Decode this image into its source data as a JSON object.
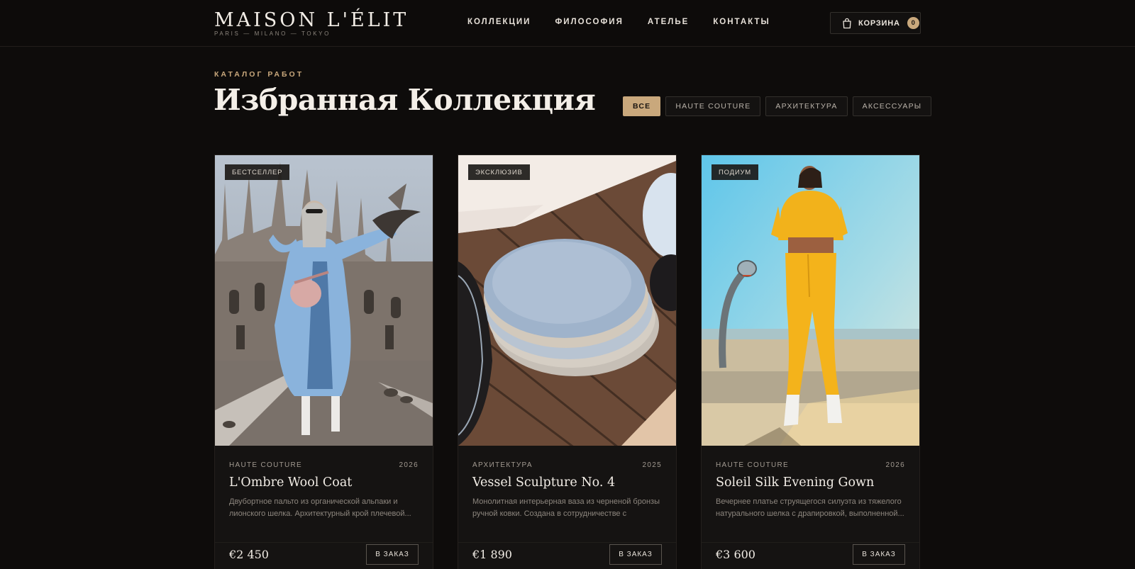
{
  "header": {
    "logo": "MAISON L'ÉLIT",
    "tagline": "PARIS — MILANO — TOKYO",
    "nav": [
      "КОЛЛЕКЦИИ",
      "ФИЛОСОФИЯ",
      "АТЕЛЬЕ",
      "КОНТАКТЫ"
    ],
    "cart_label": "КОРЗИНА",
    "cart_count": "0"
  },
  "catalog": {
    "eyebrow": "КАТАЛОГ РАБОТ",
    "title": "Избранная Коллекция",
    "filters": [
      "ВСЕ",
      "HAUTE COUTURE",
      "АРХИТЕКТУРА",
      "АКСЕССУАРЫ"
    ],
    "active_filter": "ВСЕ"
  },
  "products": [
    {
      "badge": "БЕСТСЕЛЛЕР",
      "category": "HAUTE COUTURE",
      "year": "2026",
      "title": "L'Ombre Wool Coat",
      "description": "Двубортное пальто из органической альпаки и лионского шелка. Архитектурный крой плечевой...",
      "price": "€2 450",
      "order_label": "В ЗАКАЗ"
    },
    {
      "badge": "ЭКСКЛЮЗИВ",
      "category": "АРХИТЕКТУРА",
      "year": "2025",
      "title": "Vessel Sculpture No. 4",
      "description": "Монолитная интерьерная ваза из черненой бронзы ручной ковки. Создана в сотрудничестве с миланск...",
      "price": "€1 890",
      "order_label": "В ЗАКАЗ"
    },
    {
      "badge": "ПОДИУМ",
      "category": "HAUTE COUTURE",
      "year": "2026",
      "title": "Soleil Silk Evening Gown",
      "description": "Вечернее платье струящегося силуэта из тяжелого натурального шелка с драпировкой, выполненной...",
      "price": "€3 600",
      "order_label": "В ЗАКАЗ"
    }
  ],
  "colors": {
    "accent": "#c9a87c",
    "background": "#0e0c0b",
    "card": "#151312"
  }
}
